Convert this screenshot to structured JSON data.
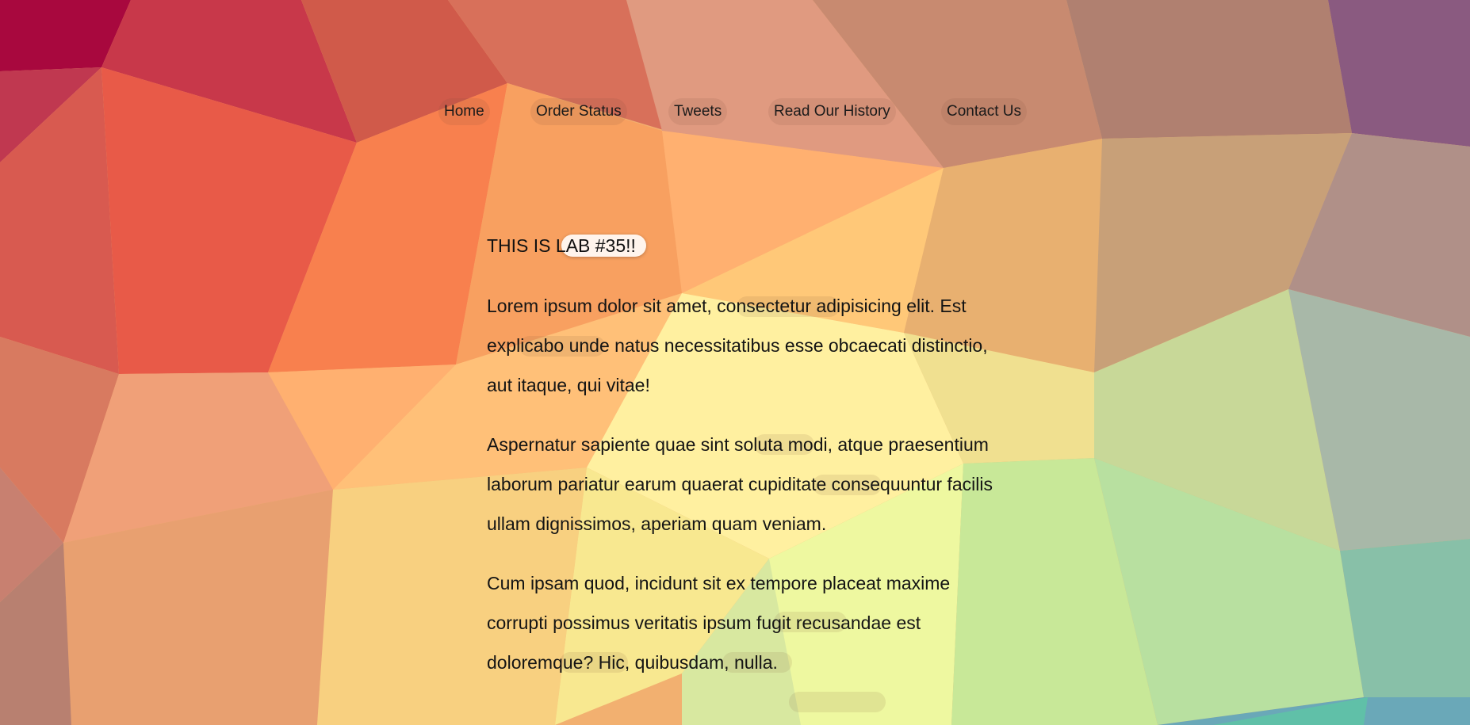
{
  "nav": {
    "items": [
      {
        "label": "Home"
      },
      {
        "label": "Order Status"
      },
      {
        "label": "Tweets"
      },
      {
        "label": "Read Our History"
      },
      {
        "label": "Contact Us"
      }
    ]
  },
  "main": {
    "heading": "THIS IS LAB #35!!",
    "paragraphs": [
      "Lorem ipsum dolor sit amet, consectetur adipisicing elit. Est explicabo unde natus necessitatibus esse obcaecati distinctio, aut itaque, qui vitae!",
      "Aspernatur sapiente quae sint soluta modi, atque praesentium laborum pariatur earum quaerat cupiditate consequuntur facilis ullam dignissimos, aperiam quam veniam.",
      "Cum ipsam quod, incidunt sit ex tempore placeat maxime corrupti possimus veritatis ipsum fugit recusandae est doloremque? Hic, quibusdam, nulla."
    ]
  },
  "background": {
    "palette": [
      "#a8083e",
      "#e8604a",
      "#ffa860",
      "#fff0a0",
      "#e8f8a0",
      "#90d8a8",
      "#6aa8b8",
      "#8a5a80"
    ]
  }
}
